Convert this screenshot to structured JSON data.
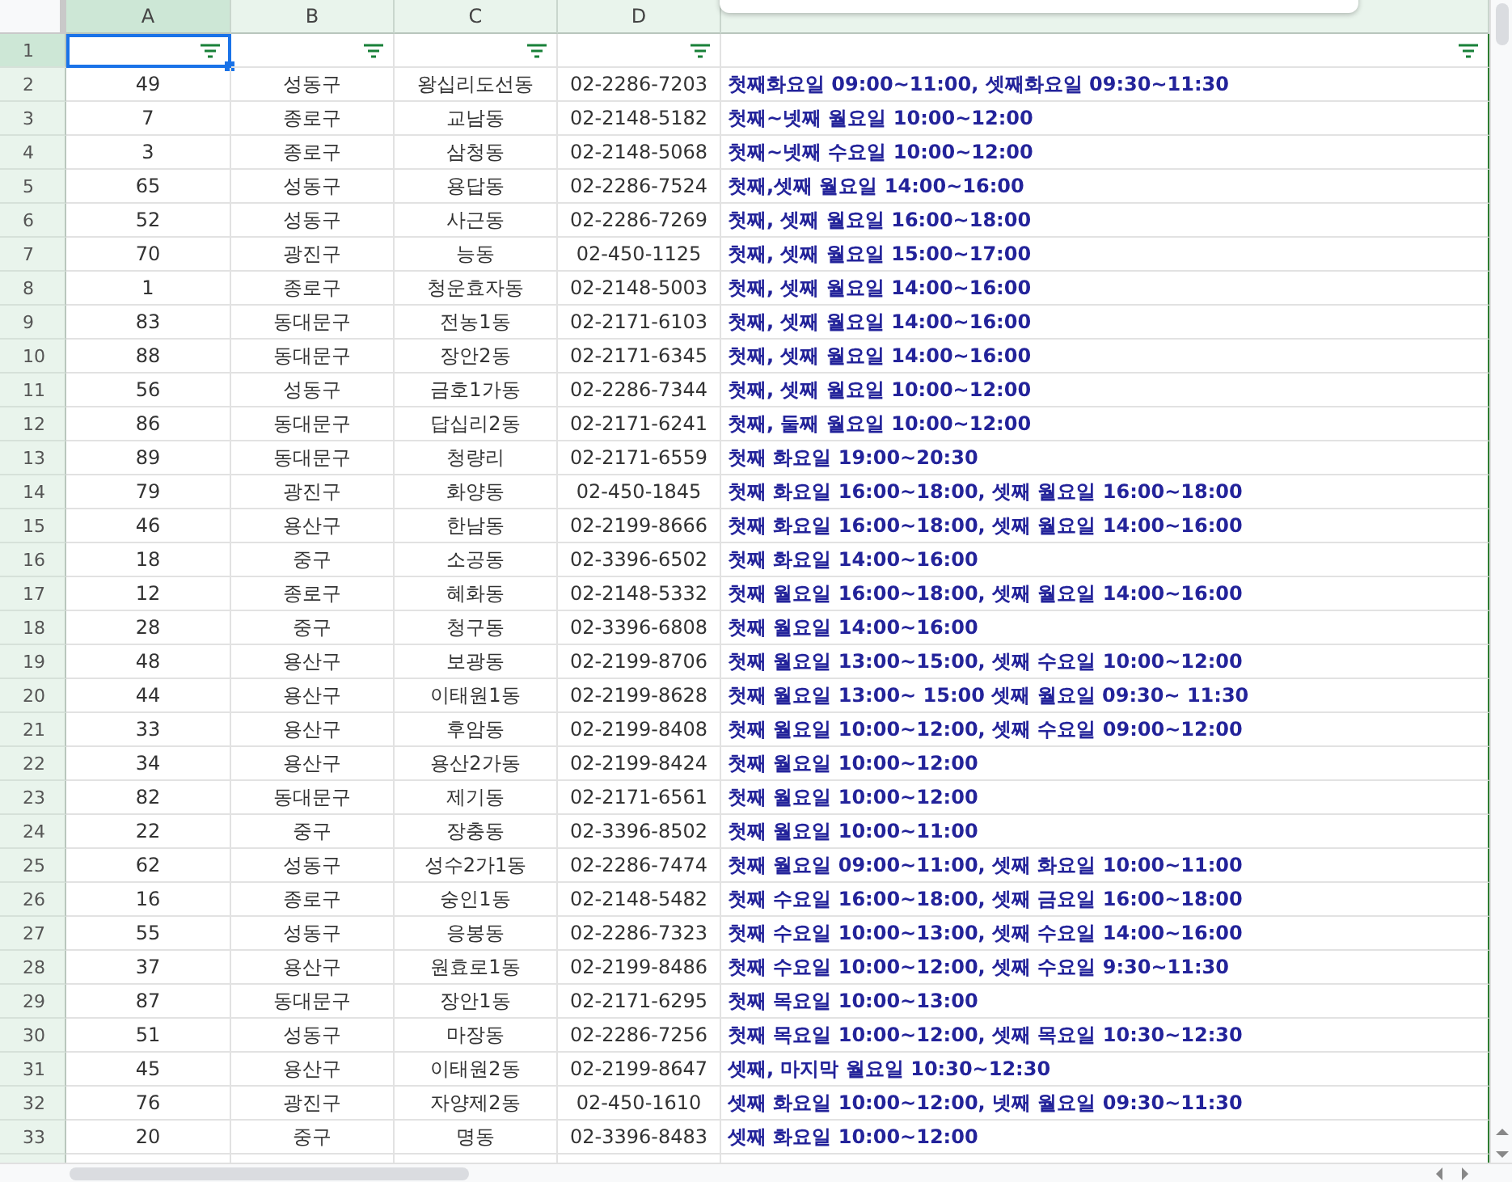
{
  "columns": [
    {
      "label": "A",
      "selected": true
    },
    {
      "label": "B",
      "selected": false
    },
    {
      "label": "C",
      "selected": false
    },
    {
      "label": "D",
      "selected": false
    }
  ],
  "filter_row": {
    "number": "1",
    "selected": true,
    "cells": [
      {
        "selected": true
      },
      {
        "selected": false
      },
      {
        "selected": false
      },
      {
        "selected": false
      }
    ]
  },
  "rows": [
    {
      "number": "2",
      "cells": [
        "49",
        "성동구",
        "왕십리도선동",
        "02-2286-7203",
        "첫째화요일 09:00~11:00, 셋째화요일 09:30~11:30"
      ]
    },
    {
      "number": "3",
      "cells": [
        "7",
        "종로구",
        "교남동",
        "02-2148-5182",
        "첫째~넷째 월요일 10:00~12:00"
      ]
    },
    {
      "number": "4",
      "cells": [
        "3",
        "종로구",
        "삼청동",
        "02-2148-5068",
        "첫째~넷째 수요일 10:00~12:00"
      ]
    },
    {
      "number": "5",
      "cells": [
        "65",
        "성동구",
        "용답동",
        "02-2286-7524",
        "첫째,셋째 월요일 14:00~16:00"
      ]
    },
    {
      "number": "6",
      "cells": [
        "52",
        "성동구",
        "사근동",
        "02-2286-7269",
        "첫째, 셋째 월요일 16:00~18:00"
      ]
    },
    {
      "number": "7",
      "cells": [
        "70",
        "광진구",
        "능동",
        "02-450-1125",
        "첫째, 셋째 월요일 15:00~17:00"
      ]
    },
    {
      "number": "8",
      "cells": [
        "1",
        "종로구",
        "청운효자동",
        "02-2148-5003",
        "첫째, 셋째 월요일 14:00~16:00"
      ]
    },
    {
      "number": "9",
      "cells": [
        "83",
        "동대문구",
        "전농1동",
        "02-2171-6103",
        "첫째, 셋째 월요일 14:00~16:00"
      ]
    },
    {
      "number": "10",
      "cells": [
        "88",
        "동대문구",
        "장안2동",
        "02-2171-6345",
        "첫째, 셋째 월요일 14:00~16:00"
      ]
    },
    {
      "number": "11",
      "cells": [
        "56",
        "성동구",
        "금호1가동",
        "02-2286-7344",
        "첫째, 셋째 월요일 10:00~12:00"
      ]
    },
    {
      "number": "12",
      "cells": [
        "86",
        "동대문구",
        "답십리2동",
        "02-2171-6241",
        "첫째, 둘째 월요일 10:00~12:00"
      ]
    },
    {
      "number": "13",
      "cells": [
        "89",
        "동대문구",
        "청량리",
        "02-2171-6559",
        "첫째 화요일 19:00~20:30"
      ]
    },
    {
      "number": "14",
      "cells": [
        "79",
        "광진구",
        "화양동",
        "02-450-1845",
        "첫째 화요일 16:00~18:00, 셋째 월요일 16:00~18:00"
      ]
    },
    {
      "number": "15",
      "cells": [
        "46",
        "용산구",
        "한남동",
        "02-2199-8666",
        "첫째 화요일 16:00~18:00, 셋째 월요일 14:00~16:00"
      ]
    },
    {
      "number": "16",
      "cells": [
        "18",
        "중구",
        "소공동",
        "02-3396-6502",
        "첫째 화요일 14:00~16:00"
      ]
    },
    {
      "number": "17",
      "cells": [
        "12",
        "종로구",
        "혜화동",
        "02-2148-5332",
        "첫째 월요일 16:00~18:00, 셋째 월요일 14:00~16:00"
      ]
    },
    {
      "number": "18",
      "cells": [
        "28",
        "중구",
        "청구동",
        "02-3396-6808",
        "첫째 월요일 14:00~16:00"
      ]
    },
    {
      "number": "19",
      "cells": [
        "48",
        "용산구",
        "보광동",
        "02-2199-8706",
        "첫째 월요일 13:00~15:00, 셋째 수요일 10:00~12:00"
      ]
    },
    {
      "number": "20",
      "cells": [
        "44",
        "용산구",
        "이태원1동",
        "02-2199-8628",
        "첫째 월요일 13:00~ 15:00 셋째 월요일 09:30~ 11:30"
      ]
    },
    {
      "number": "21",
      "cells": [
        "33",
        "용산구",
        "후암동",
        "02-2199-8408",
        "첫째 월요일 10:00~12:00, 셋째 수요일 09:00~12:00"
      ]
    },
    {
      "number": "22",
      "cells": [
        "34",
        "용산구",
        "용산2가동",
        "02-2199-8424",
        "첫째 월요일 10:00~12:00"
      ]
    },
    {
      "number": "23",
      "cells": [
        "82",
        "동대문구",
        "제기동",
        "02-2171-6561",
        "첫째 월요일 10:00~12:00"
      ]
    },
    {
      "number": "24",
      "cells": [
        "22",
        "중구",
        "장충동",
        "02-3396-8502",
        "첫째 월요일 10:00~11:00"
      ]
    },
    {
      "number": "25",
      "cells": [
        "62",
        "성동구",
        "성수2가1동",
        "02-2286-7474",
        "첫째 월요일 09:00~11:00, 셋째 화요일 10:00~11:00"
      ]
    },
    {
      "number": "26",
      "cells": [
        "16",
        "종로구",
        "숭인1동",
        "02-2148-5482",
        "첫째 수요일 16:00~18:00, 셋째 금요일 16:00~18:00"
      ]
    },
    {
      "number": "27",
      "cells": [
        "55",
        "성동구",
        "응봉동",
        "02-2286-7323",
        "첫째 수요일 10:00~13:00, 셋째 수요일 14:00~16:00"
      ]
    },
    {
      "number": "28",
      "cells": [
        "37",
        "용산구",
        "원효로1동",
        "02-2199-8486",
        "첫째 수요일 10:00~12:00, 셋째 수요일 9:30~11:30"
      ]
    },
    {
      "number": "29",
      "cells": [
        "87",
        "동대문구",
        "장안1동",
        "02-2171-6295",
        "첫째 목요일 10:00~13:00"
      ]
    },
    {
      "number": "30",
      "cells": [
        "51",
        "성동구",
        "마장동",
        "02-2286-7256",
        "첫째 목요일 10:00~12:00, 셋째 목요일 10:30~12:30"
      ]
    },
    {
      "number": "31",
      "cells": [
        "45",
        "용산구",
        "이태원2동",
        "02-2199-8647",
        "셋째, 마지막 월요일 10:30~12:30"
      ]
    },
    {
      "number": "32",
      "cells": [
        "76",
        "광진구",
        "자양제2동",
        "02-450-1610",
        "셋째 화요일 10:00~12:00, 넷째 월요일 09:30~11:30"
      ]
    },
    {
      "number": "33",
      "cells": [
        "20",
        "중구",
        "명동",
        "02-3396-8483",
        "셋째 화요일 10:00~12:00"
      ]
    }
  ]
}
